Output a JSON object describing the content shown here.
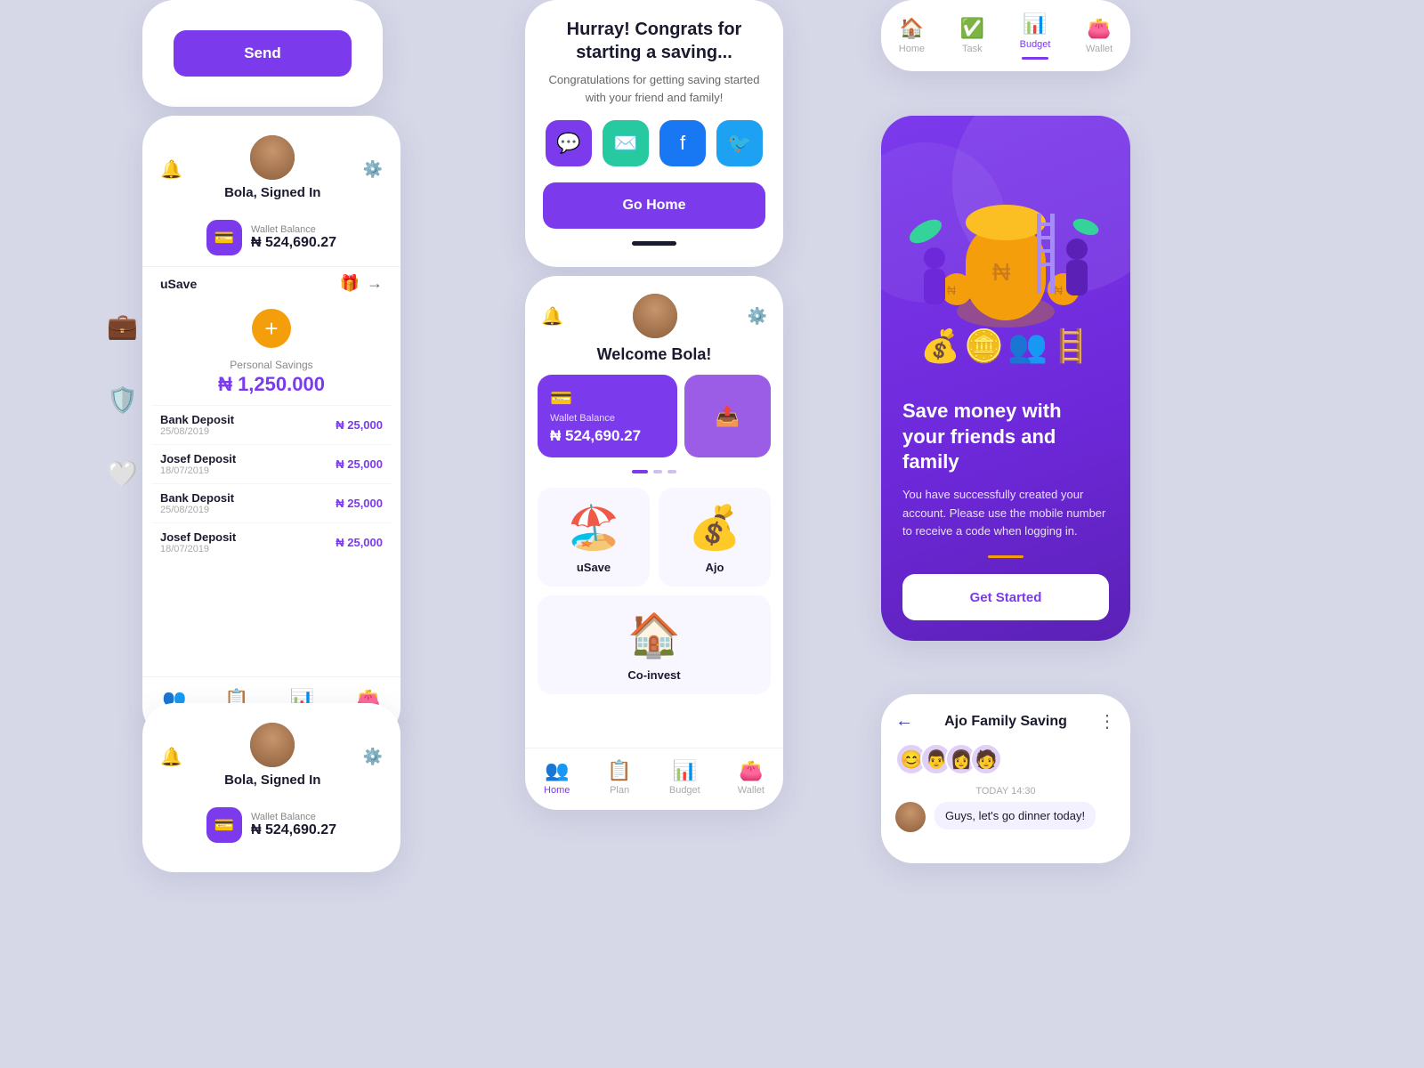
{
  "app": {
    "background": "#d6d8e8"
  },
  "card_send": {
    "button_label": "Send"
  },
  "card_home": {
    "user_name": "Bola, Signed In",
    "wallet_label": "Wallet Balance",
    "wallet_amount": "₦ 524,690.27",
    "usave_label": "uSave",
    "savings_label": "Personal Savings",
    "savings_amount": "₦ 1,250.000",
    "transactions": [
      {
        "name": "Bank Deposit",
        "date": "25/08/2019",
        "amount": "₦ 25,000"
      },
      {
        "name": "Josef Deposit",
        "date": "18/07/2019",
        "amount": "₦ 25,000"
      },
      {
        "name": "Bank Deposit",
        "date": "25/08/2019",
        "amount": "₦ 25,000"
      },
      {
        "name": "Josef Deposit",
        "date": "18/07/2019",
        "amount": "₦ 25,000"
      }
    ],
    "nav": [
      {
        "label": "Home",
        "active": true
      },
      {
        "label": "Plan",
        "active": false
      },
      {
        "label": "Budget",
        "active": false
      },
      {
        "label": "Wallet",
        "active": false
      }
    ]
  },
  "card_congrats": {
    "title": "Hurray! Congrats for starting a saving...",
    "subtitle": "Congratulations for getting saving started with your friend and family!",
    "go_home_label": "Go Home"
  },
  "card_welcome": {
    "user_name": "Welcome Bola!",
    "wallet_label": "Wallet Balance",
    "wallet_amount": "₦ 524,690.27",
    "features": [
      {
        "label": "uSave"
      },
      {
        "label": "Ajo"
      },
      {
        "label": "Co-invest"
      }
    ],
    "nav": [
      {
        "label": "Home",
        "active": true
      },
      {
        "label": "Plan",
        "active": false
      },
      {
        "label": "Budget",
        "active": false
      },
      {
        "label": "Wallet",
        "active": false
      }
    ]
  },
  "card_purple": {
    "title": "Save money with your friends and family",
    "subtitle": "You have successfully created your account. Please use the mobile number to receive a code when logging in.",
    "get_started_label": "Get Started"
  },
  "card_budget_nav": {
    "items": [
      {
        "label": "Home",
        "active": false
      },
      {
        "label": "Task",
        "active": false
      },
      {
        "label": "Budget",
        "active": true
      },
      {
        "label": "Wallet",
        "active": false
      }
    ]
  },
  "card_ajo": {
    "title": "Ajo Family Saving",
    "timestamp": "TODAY 14:30",
    "message": "Guys, let's go dinner today!"
  },
  "card_home_bottom": {
    "user_name": "Bola, Signed In",
    "wallet_label": "Wallet Balance",
    "wallet_amount": "₦ 524,690.27"
  }
}
